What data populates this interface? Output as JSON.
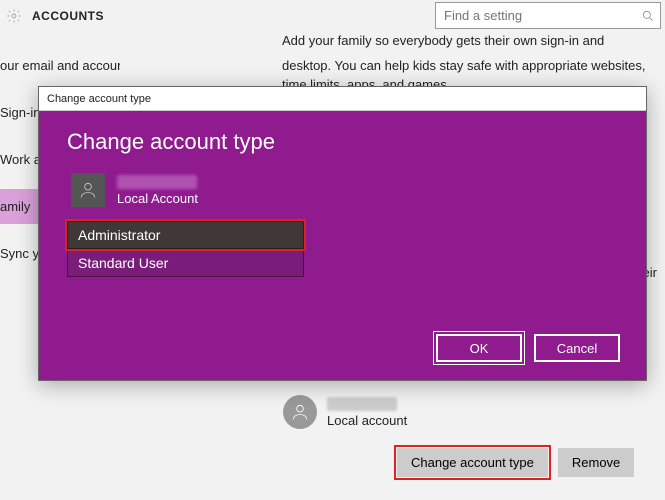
{
  "header": {
    "title": "ACCOUNTS"
  },
  "search": {
    "placeholder": "Find a setting"
  },
  "sidebar": {
    "items": [
      {
        "label": "our email and accounts"
      },
      {
        "label": "Sign-in"
      },
      {
        "label": "Work a"
      },
      {
        "label": "amily "
      },
      {
        "label": "Sync yo"
      }
    ],
    "selected_index": 3
  },
  "content": {
    "intro_line1": "Add your family so everybody gets their own sign-in and",
    "intro_line2": "desktop. You can help kids stay safe with appropriate websites, time limits, apps, and games.",
    "snippet_right": "their"
  },
  "user_card": {
    "account_type": "Local account",
    "change_btn": "Change account type",
    "remove_btn": "Remove"
  },
  "dialog": {
    "window_title": "Change account type",
    "heading": "Change account type",
    "account_type": "Local Account",
    "options": [
      "Administrator",
      "Standard User"
    ],
    "selected_option": 0,
    "ok": "OK",
    "cancel": "Cancel"
  }
}
